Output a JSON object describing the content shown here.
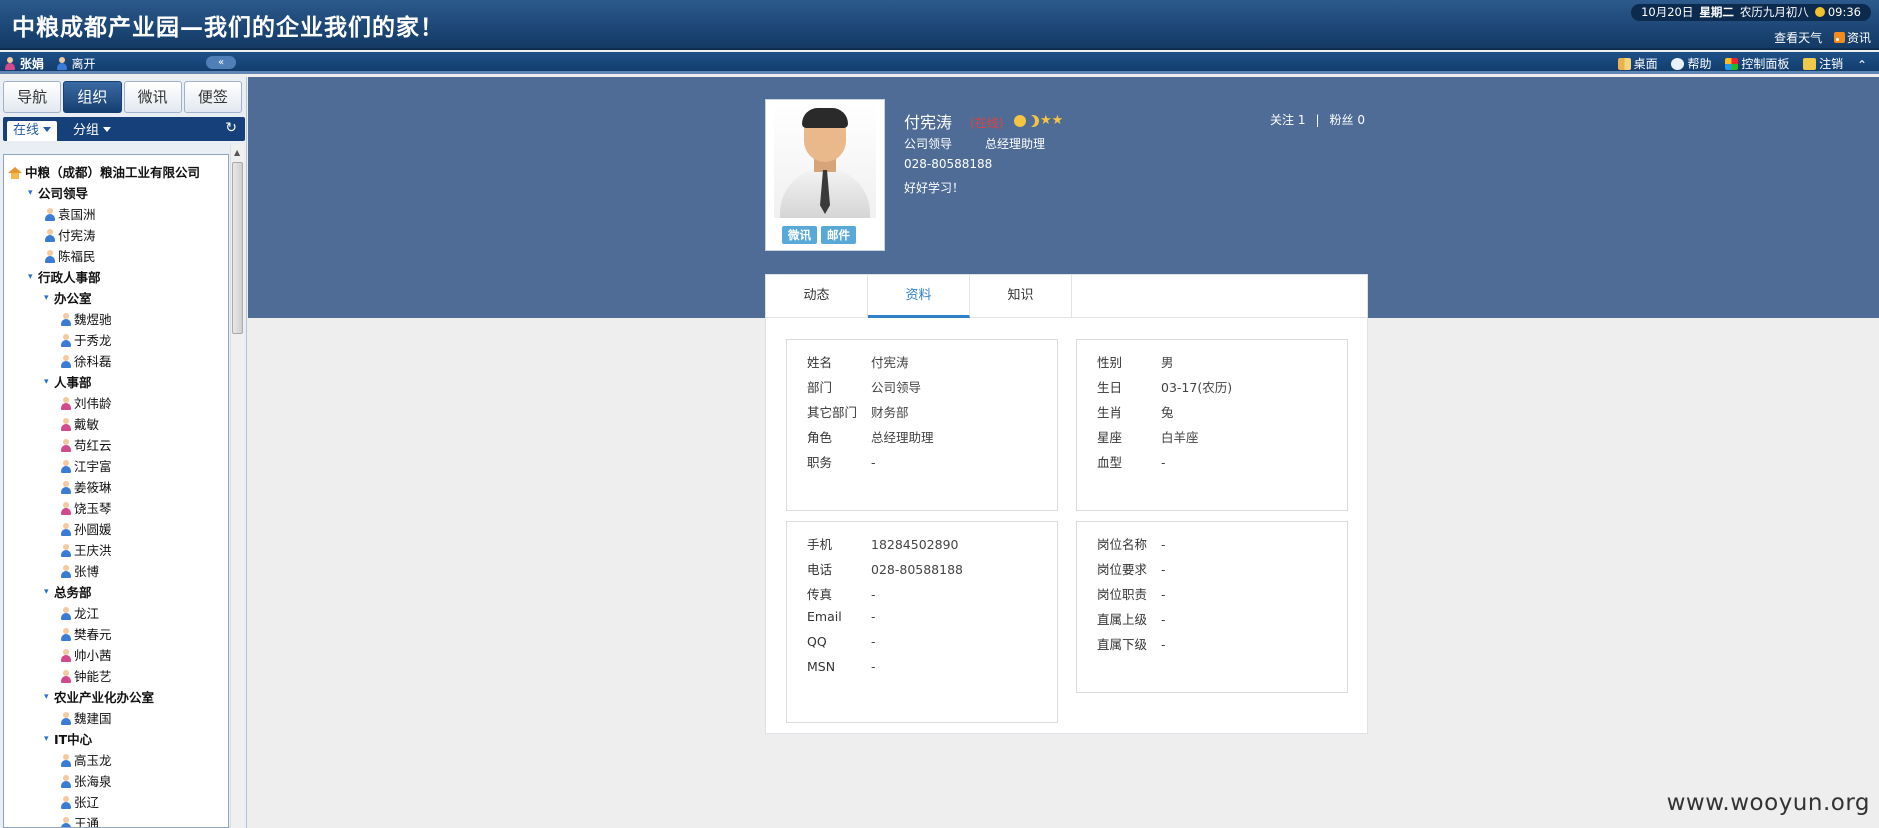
{
  "banner": {
    "title": "中粮成都产业园—我们的企业我们的家！",
    "date": "10月20日",
    "weekday": "星期二",
    "lunar": "农历九月初八",
    "time": "09:36",
    "weather_link": "查看天气",
    "news_link": "资讯"
  },
  "userbar": {
    "user": "张娟",
    "status": "离开",
    "desktop": "桌面",
    "help": "帮助",
    "control_panel": "控制面板",
    "logout": "注销"
  },
  "sidebar": {
    "tabs": [
      {
        "label": "导航",
        "active": false
      },
      {
        "label": "组织",
        "active": true
      },
      {
        "label": "微讯",
        "active": false
      },
      {
        "label": "便签",
        "active": false
      }
    ],
    "subtab_online": "在线",
    "subtab_group": "分组",
    "tree": [
      {
        "label": "中粮（成都）粮油工业有限公司",
        "kind": "root",
        "level": 0
      },
      {
        "label": "公司领导",
        "kind": "group",
        "level": 1
      },
      {
        "label": "袁国洲",
        "kind": "user",
        "level": 2,
        "gender": "m"
      },
      {
        "label": "付宪涛",
        "kind": "user",
        "level": 2,
        "gender": "m"
      },
      {
        "label": "陈福民",
        "kind": "user",
        "level": 2,
        "gender": "m"
      },
      {
        "label": "行政人事部",
        "kind": "group",
        "level": 1
      },
      {
        "label": "办公室",
        "kind": "group",
        "level": 2
      },
      {
        "label": "魏煜驰",
        "kind": "user",
        "level": 3,
        "gender": "m"
      },
      {
        "label": "于秀龙",
        "kind": "user",
        "level": 3,
        "gender": "m"
      },
      {
        "label": "徐科磊",
        "kind": "user",
        "level": 3,
        "gender": "m"
      },
      {
        "label": "人事部",
        "kind": "group",
        "level": 2
      },
      {
        "label": "刘伟龄",
        "kind": "user",
        "level": 3,
        "gender": "f"
      },
      {
        "label": "戴敏",
        "kind": "user",
        "level": 3,
        "gender": "f"
      },
      {
        "label": "苟红云",
        "kind": "user",
        "level": 3,
        "gender": "f"
      },
      {
        "label": "江宇富",
        "kind": "user",
        "level": 3,
        "gender": "m"
      },
      {
        "label": "姜筱琳",
        "kind": "user",
        "level": 3,
        "gender": "m"
      },
      {
        "label": "饶玉琴",
        "kind": "user",
        "level": 3,
        "gender": "f"
      },
      {
        "label": "孙圆媛",
        "kind": "user",
        "level": 3,
        "gender": "m"
      },
      {
        "label": "王庆洪",
        "kind": "user",
        "level": 3,
        "gender": "m"
      },
      {
        "label": "张博",
        "kind": "user",
        "level": 3,
        "gender": "m"
      },
      {
        "label": "总务部",
        "kind": "group",
        "level": 2
      },
      {
        "label": "龙江",
        "kind": "user",
        "level": 3,
        "gender": "m"
      },
      {
        "label": "樊春元",
        "kind": "user",
        "level": 3,
        "gender": "m"
      },
      {
        "label": "帅小茜",
        "kind": "user",
        "level": 3,
        "gender": "f"
      },
      {
        "label": "钟能艺",
        "kind": "user",
        "level": 3,
        "gender": "f"
      },
      {
        "label": "农业产业化办公室",
        "kind": "group",
        "level": 2
      },
      {
        "label": "魏建国",
        "kind": "user",
        "level": 3,
        "gender": "m"
      },
      {
        "label": "IT中心",
        "kind": "group",
        "level": 2
      },
      {
        "label": "高玉龙",
        "kind": "user",
        "level": 3,
        "gender": "m"
      },
      {
        "label": "张海泉",
        "kind": "user",
        "level": 3,
        "gender": "m"
      },
      {
        "label": "张辽",
        "kind": "user",
        "level": 3,
        "gender": "m"
      },
      {
        "label": "王通",
        "kind": "user",
        "level": 3,
        "gender": "m"
      }
    ]
  },
  "profile": {
    "name": "付宪涛",
    "status": "(在线)",
    "dept": "公司领导",
    "role": "总经理助理",
    "phone": "028-80588188",
    "motto": "好好学习！",
    "follow_label": "关注",
    "follow_count": "1",
    "fans_label": "粉丝",
    "fans_count": "0",
    "btn_weixun": "微讯",
    "btn_mail": "邮件"
  },
  "tabs": [
    {
      "label": "动态",
      "active": false
    },
    {
      "label": "资料",
      "active": true
    },
    {
      "label": "知识",
      "active": false
    }
  ],
  "basic_left": [
    {
      "label": "姓名",
      "value": "付宪涛"
    },
    {
      "label": "部门",
      "value": "公司领导"
    },
    {
      "label": "其它部门",
      "value": "财务部"
    },
    {
      "label": "角色",
      "value": "总经理助理"
    },
    {
      "label": "职务",
      "value": "-"
    }
  ],
  "basic_right": [
    {
      "label": "性别",
      "value": "男"
    },
    {
      "label": "生日",
      "value": "03-17(农历)"
    },
    {
      "label": "生肖",
      "value": "兔"
    },
    {
      "label": "星座",
      "value": "白羊座"
    },
    {
      "label": "血型",
      "value": "-"
    }
  ],
  "contact": [
    {
      "label": "手机",
      "value": "18284502890"
    },
    {
      "label": "电话",
      "value": "028-80588188"
    },
    {
      "label": "传真",
      "value": "-"
    },
    {
      "label": "Email",
      "value": "-"
    },
    {
      "label": "QQ",
      "value": "-"
    },
    {
      "label": "MSN",
      "value": "-"
    }
  ],
  "position": [
    {
      "label": "岗位名称",
      "value": "-"
    },
    {
      "label": "岗位要求",
      "value": "-"
    },
    {
      "label": "岗位职责",
      "value": "-"
    },
    {
      "label": "直属上级",
      "value": "-"
    },
    {
      "label": "直属下级",
      "value": "-"
    }
  ],
  "watermark": "www.wooyun.org"
}
